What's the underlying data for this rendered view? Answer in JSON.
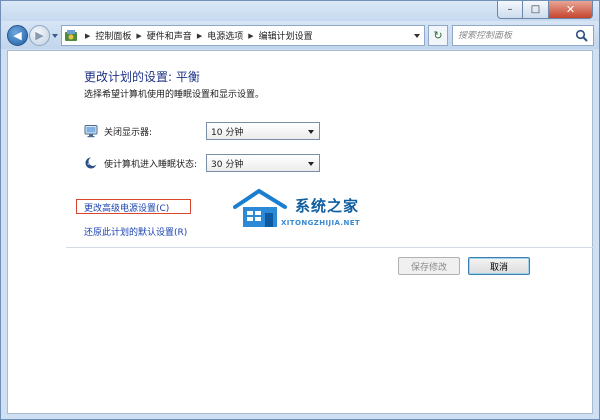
{
  "window": {
    "caption": {
      "minimize_glyph": "–",
      "maximize_glyph": "□",
      "close_glyph": "✕"
    }
  },
  "navigation": {
    "back_glyph": "◀",
    "forward_glyph": "▶",
    "breadcrumbs": [
      "控制面板",
      "硬件和声音",
      "电源选项",
      "编辑计划设置"
    ],
    "search_placeholder": "搜索控制面板",
    "refresh_glyph": "↻"
  },
  "main": {
    "title": "更改计划的设置: 平衡",
    "subtitle": "选择希望计算机使用的睡眠设置和显示设置。",
    "settings": [
      {
        "label": "关闭显示器:",
        "value": "10 分钟",
        "icon": "monitor-icon"
      },
      {
        "label": "使计算机进入睡眠状态:",
        "value": "30 分钟",
        "icon": "moon-icon"
      }
    ],
    "links": {
      "advanced": "更改高级电源设置(C)",
      "restore": "还原此计划的默认设置(R)"
    },
    "buttons": {
      "save": "保存修改",
      "cancel": "取消"
    }
  },
  "watermark": {
    "name": "系统之家",
    "url": "XITONGZHIJIA.NET"
  },
  "colors": {
    "heading": "#1e3287",
    "link": "#1a44b2",
    "highlight_box": "#d94630",
    "watermark": "#0f5ea0"
  }
}
